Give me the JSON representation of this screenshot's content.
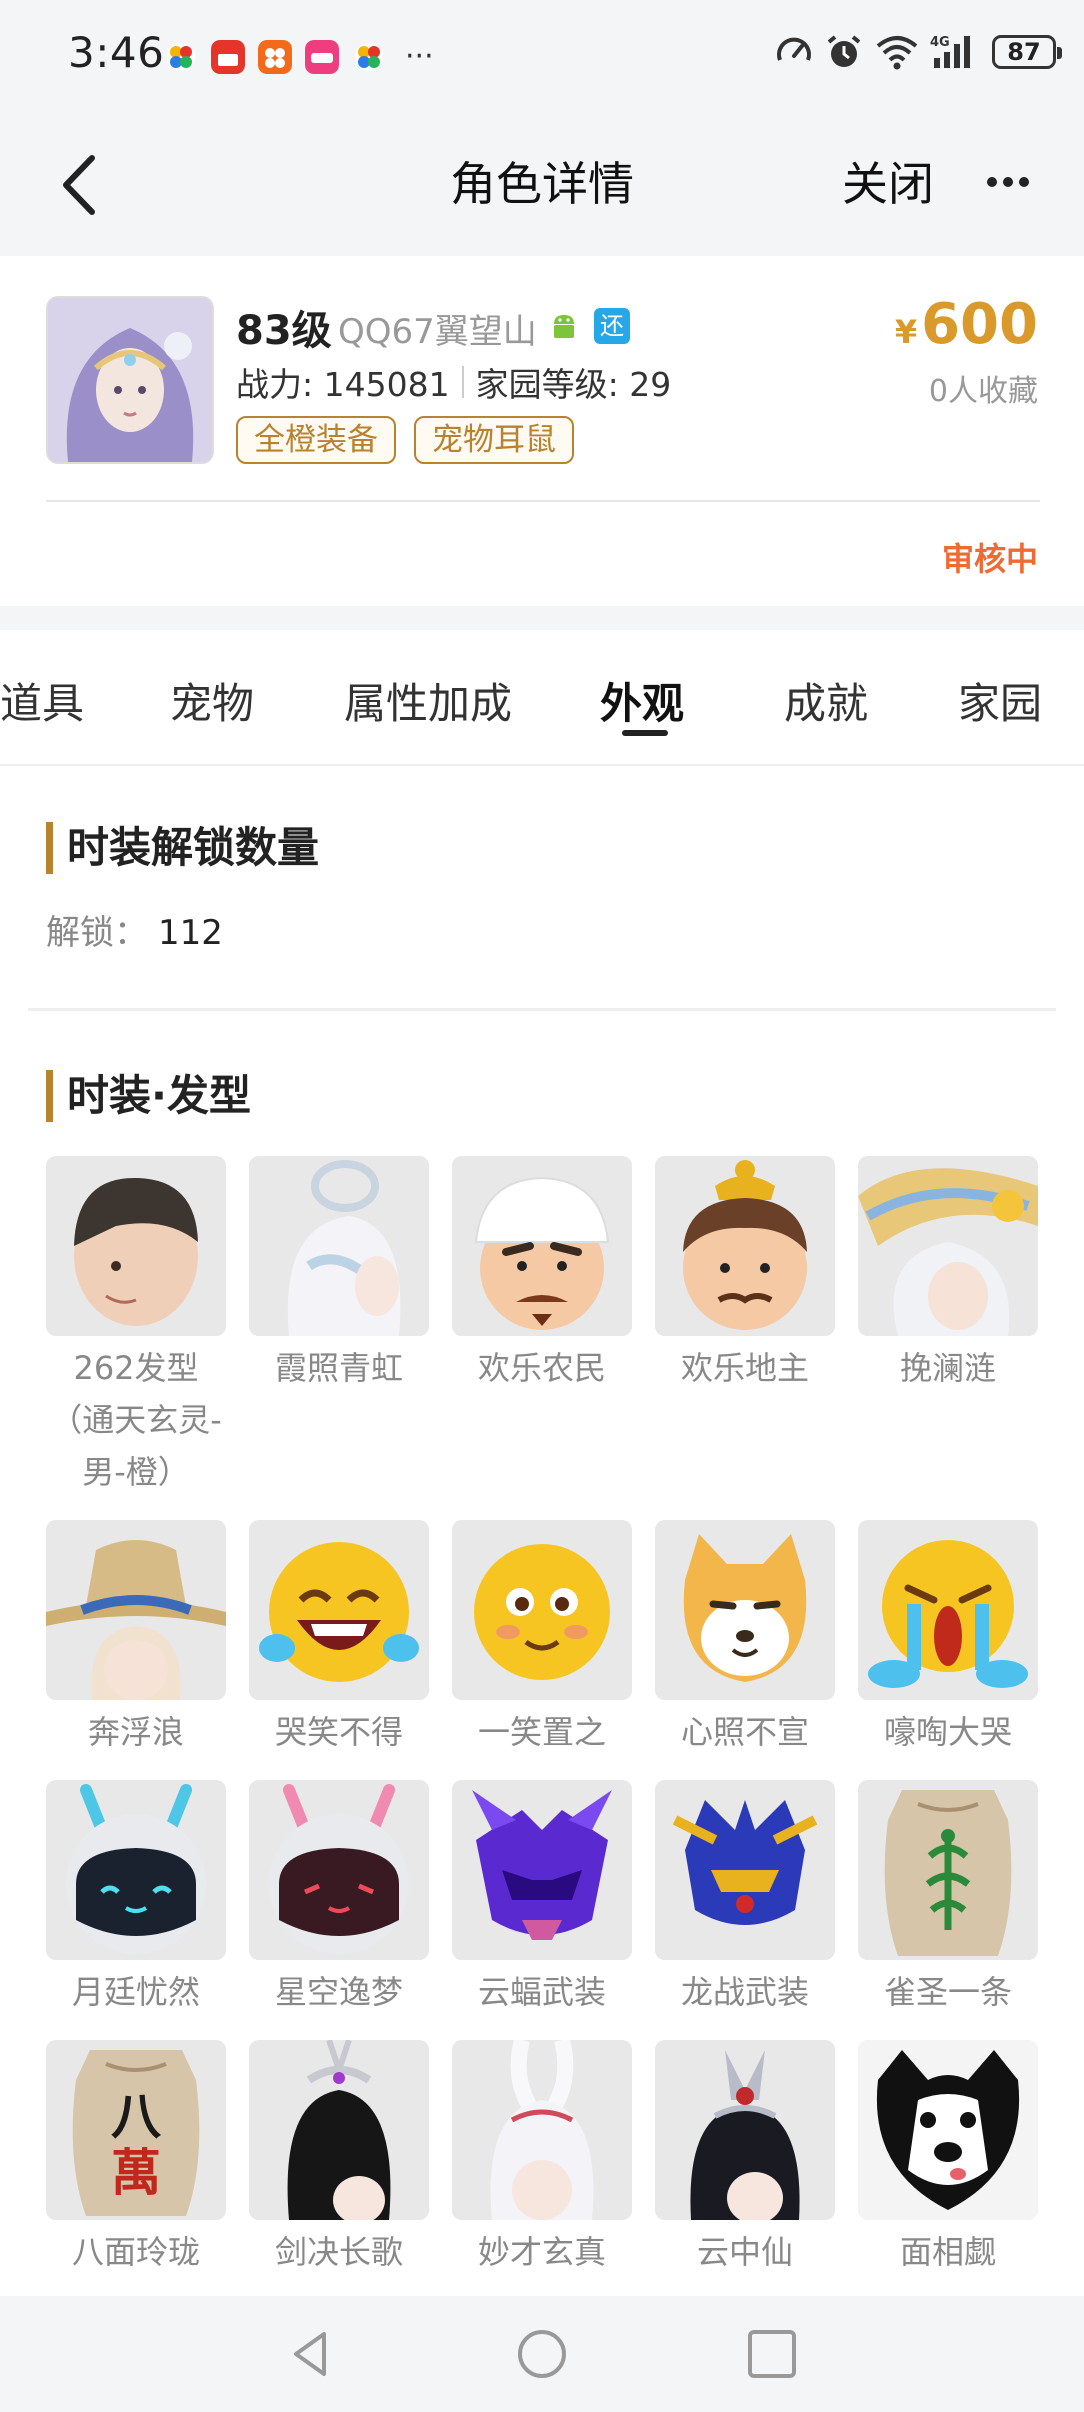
{
  "status_bar": {
    "time": "3:46",
    "battery": "87"
  },
  "header": {
    "title": "角色详情",
    "close_label": "关闭"
  },
  "profile": {
    "level": "83级",
    "server": "QQ67翼望山",
    "restore_badge": "还",
    "power": "战力: 145081",
    "home_level": "家园等级: 29",
    "tags": [
      "全橙装备",
      "宠物耳鼠"
    ],
    "currency": "¥",
    "price": "600",
    "favorites": "0人收藏",
    "status": "审核中"
  },
  "tabs": [
    "道具",
    "宠物",
    "属性加成",
    "外观",
    "成就",
    "家园"
  ],
  "active_tab": "外观",
  "unlock_section": {
    "title": "时装解锁数量",
    "label": "解锁：",
    "value": "112"
  },
  "hair_section": {
    "title": "时装·发型",
    "items": [
      "262发型（通天玄灵-男-橙）",
      "霞照青虹",
      "欢乐农民",
      "欢乐地主",
      "挽澜涟",
      "奔浮浪",
      "哭笑不得",
      "一笑置之",
      "心照不宣",
      "嚎啕大哭",
      "月廷忧然",
      "星空逸梦",
      "云蝠武装",
      "龙战武装",
      "雀圣一条",
      "八面玲珑",
      "剑决长歌",
      "妙才玄真",
      "云中仙",
      "面相觑"
    ],
    "tile_text": [
      "八",
      "萬"
    ]
  },
  "colors": {
    "accent": "#b8822f",
    "price": "#d99a2b",
    "status": "#ef6b35",
    "badge": "#25a7e8"
  }
}
